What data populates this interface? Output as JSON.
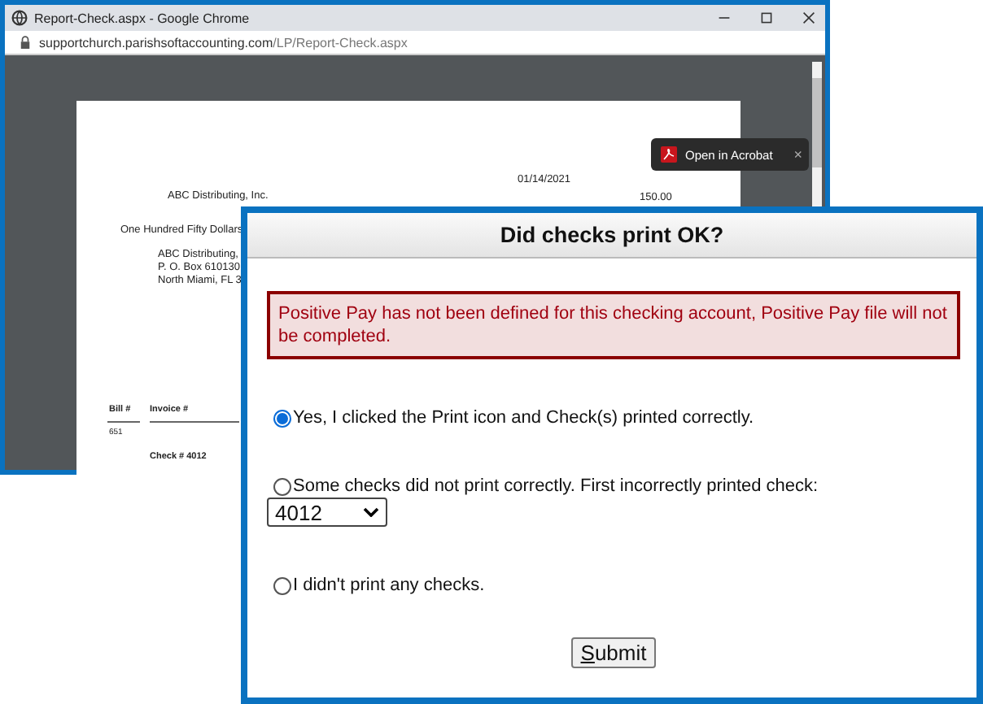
{
  "browser": {
    "title": "Report-Check.aspx - Google Chrome",
    "url_host": "supportchurch.parishsoftaccounting.com",
    "url_path": "/LP/Report-Check.aspx",
    "acrobat_popup": {
      "label": "Open in Acrobat",
      "close": "×"
    },
    "document": {
      "date": "01/14/2021",
      "payee": "ABC Distributing, Inc.",
      "amount": "150.00",
      "amount_words": "One Hundred Fifty Dollars",
      "address_lines": [
        "ABC Distributing,",
        "P. O. Box 610130",
        "North Miami, FL 3"
      ],
      "columns": [
        "Bill #",
        "Invoice #"
      ],
      "bill": "651",
      "check_number": "Check # 4012"
    }
  },
  "dialog": {
    "title": "Did checks print OK?",
    "error": "Positive Pay has not been defined for this checking account, Positive Pay file will not be completed.",
    "options": [
      {
        "label": "Yes, I clicked the Print icon and Check(s) printed correctly.",
        "selected": true,
        "kind": "plain"
      },
      {
        "label": "Some checks did not print correctly. First incorrectly printed check:",
        "selected": false,
        "kind": "select",
        "select_value": "4012"
      },
      {
        "label": "I didn't print any checks.",
        "selected": false,
        "kind": "plain"
      }
    ],
    "submit": {
      "label": "Submit",
      "mnemonic_underlined": true
    }
  }
}
